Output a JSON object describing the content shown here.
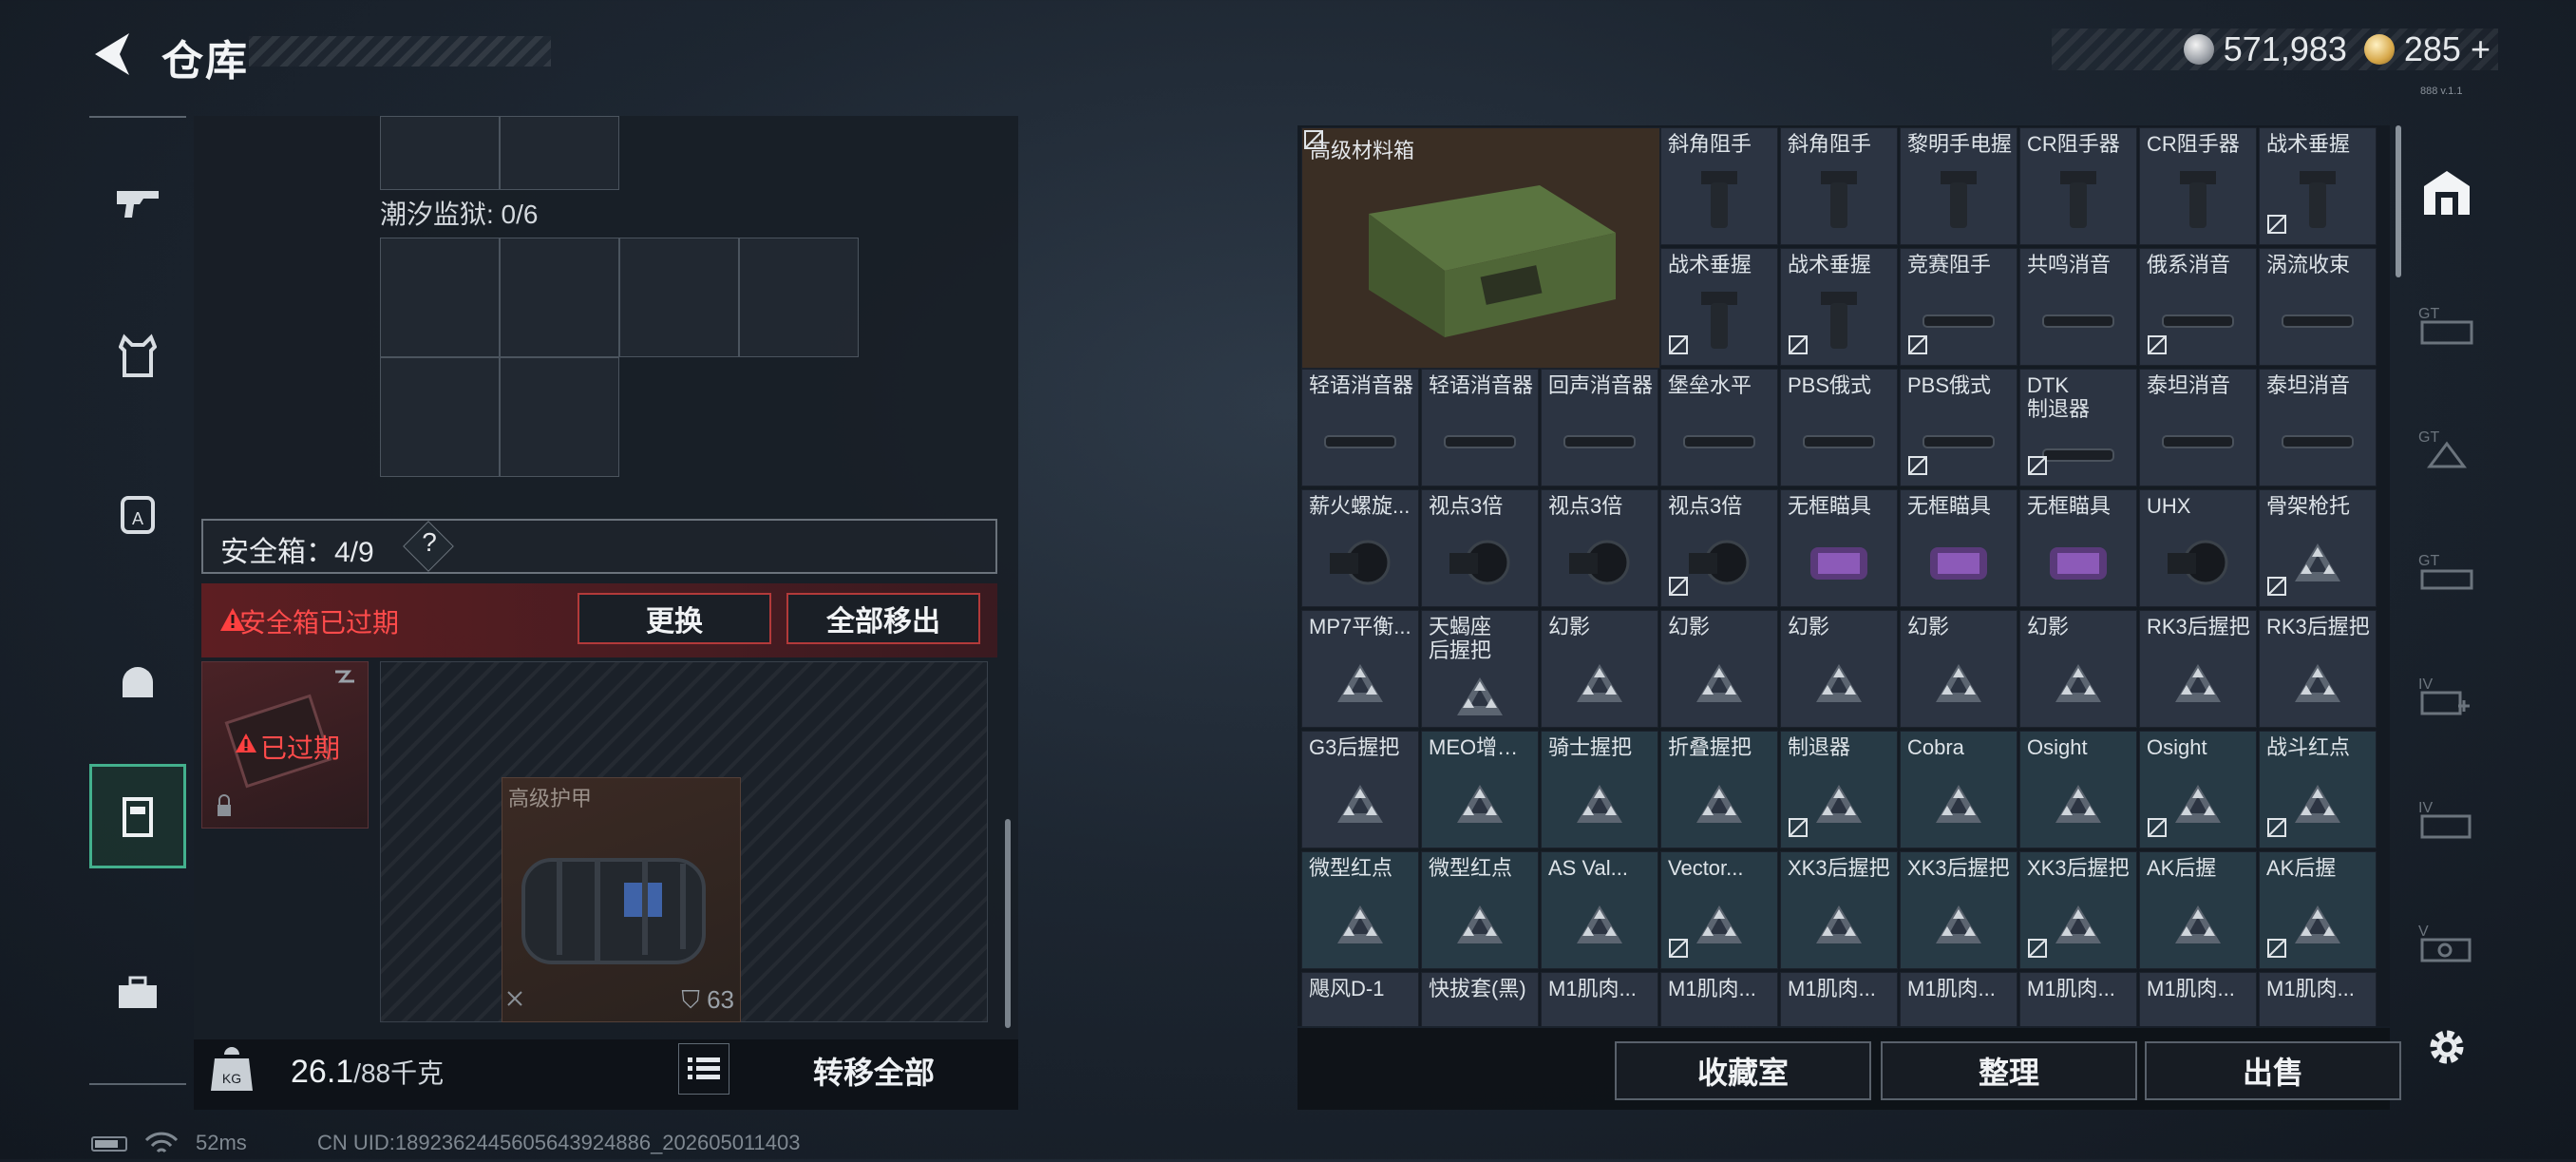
{
  "header": {
    "title": "仓库"
  },
  "currency": {
    "silver": "571,983",
    "gold": "285"
  },
  "version_tiny": "888 v.1.1",
  "left_nav": [
    "weapons",
    "armor",
    "backpack",
    "helmet",
    "container",
    "toolbox"
  ],
  "left_panel": {
    "tide_label": "潮汐监狱: 0/6",
    "safe_label": "安全箱：4/9",
    "safe_help": "?",
    "expired_label": "安全箱已过期",
    "replace_label": "更换",
    "remove_all_label": "全部移出",
    "safebox_badge": "已过期",
    "armor_name": "高级护甲",
    "armor_durability": "63",
    "weight_current": "26.1",
    "weight_max": "/88千克",
    "transfer_all_label": "转移全部"
  },
  "status": {
    "ping": "52ms",
    "uid": "CN UID:1892362445605643924886_202605011403"
  },
  "grid": {
    "big_item": "高级材料箱",
    "rows": [
      [
        "",
        "",
        "",
        "斜角阻手",
        "斜角阻手",
        "黎明手电握",
        "CR阻手器",
        "CR阻手器",
        "战术垂握"
      ],
      [
        "",
        "",
        "",
        "战术垂握",
        "战术垂握",
        "竞赛阻手",
        "共鸣消音",
        "俄系消音",
        "涡流收束"
      ],
      [
        "轻语消音器",
        "轻语消音器",
        "回声消音器",
        "堡垒水平",
        "PBS俄式",
        "PBS俄式",
        "DTK\n制退器",
        "泰坦消音",
        "泰坦消音"
      ],
      [
        "薪火螺旋...",
        "视点3倍",
        "视点3倍",
        "视点3倍",
        "无框瞄具",
        "无框瞄具",
        "无框瞄具",
        "UHX",
        "骨架枪托"
      ],
      [
        "MP7平衡...",
        "天蝎座\n后握把",
        "幻影",
        "幻影",
        "幻影",
        "幻影",
        "幻影",
        "RK3后握把",
        "RK3后握把"
      ],
      [
        "G3后握把",
        "MEO增高架",
        "骑士握把",
        "折叠握把",
        "制退器",
        "Cobra",
        "Osight",
        "Osight",
        "战斗红点"
      ],
      [
        "微型红点",
        "微型红点",
        "AS Val...",
        "Vector...",
        "XK3后握把",
        "XK3后握把",
        "XK3后握把",
        "AK后握",
        "AK后握"
      ],
      [
        "飓风D-1",
        "快拔套(黑)",
        "M1肌肉...",
        "M1肌肉...",
        "M1肌肉...",
        "M1肌肉...",
        "M1肌肉...",
        "M1肌肉...",
        "M1肌肉..."
      ]
    ]
  },
  "bottom_buttons": {
    "collection": "收藏室",
    "sort": "整理",
    "sell": "出售"
  }
}
